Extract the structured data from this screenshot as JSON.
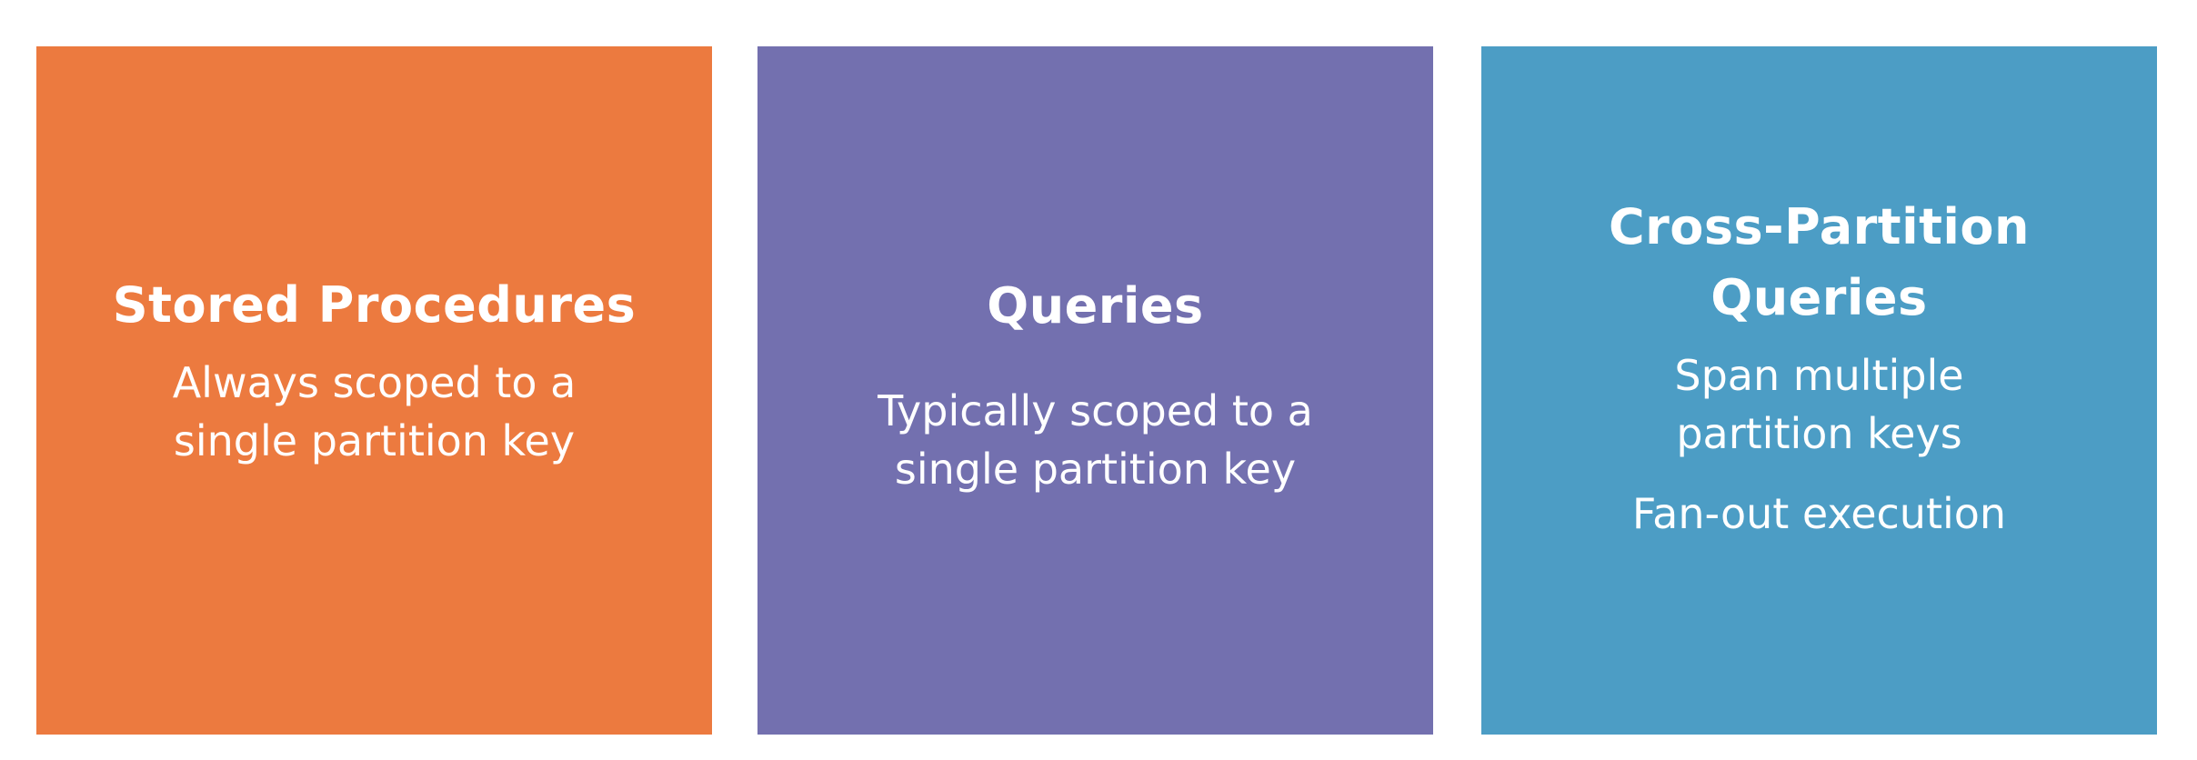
{
  "cards": [
    {
      "title": "Stored Procedures",
      "description_lines": [
        "Always scoped to a",
        "single partition key"
      ],
      "color": "#EC7A3F"
    },
    {
      "title": "Queries",
      "description_lines": [
        "Typically scoped to a",
        "single partition key"
      ],
      "color": "#7370AF"
    },
    {
      "title_lines": [
        "Cross-Partition",
        "Queries"
      ],
      "description_lines": [
        "Span multiple",
        "partition keys"
      ],
      "note": "Fan-out execution",
      "color": "#4C9DC5"
    }
  ]
}
